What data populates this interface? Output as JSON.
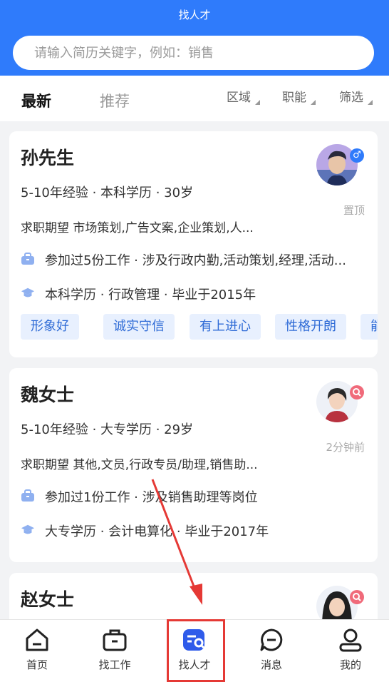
{
  "header": {
    "title": "找人才",
    "search_placeholder": "请输入简历关键字，例如：销售"
  },
  "filterbar": {
    "tabs": [
      {
        "label": "最新",
        "active": true
      },
      {
        "label": "推荐",
        "active": false
      }
    ],
    "filters": [
      {
        "label": "区域"
      },
      {
        "label": "职能"
      },
      {
        "label": "筛选"
      }
    ]
  },
  "candidates": [
    {
      "name": "孙先生",
      "summary": "5-10年经验 · 本科学历 · 30岁",
      "expectation": "求职期望 市场策划,广告文案,企业策划,人...",
      "work": "参加过5份工作 · 涉及行政内勤,活动策划,经理,活动...",
      "education": "本科学历 · 行政管理 · 毕业于2015年",
      "side_label": "置顶",
      "badge": "male-icon",
      "tags": [
        "形象好",
        "诚实守信",
        "有上进心",
        "性格开朗",
        "能"
      ]
    },
    {
      "name": "魏女士",
      "summary": "5-10年经验 · 大专学历 · 29岁",
      "expectation": "求职期望 其他,文员,行政专员/助理,销售助...",
      "work": "参加过1份工作 · 涉及销售助理等岗位",
      "education": "大专学历 · 会计电算化 · 毕业于2017年",
      "side_label": "2分钟前",
      "badge": "search-icon"
    },
    {
      "name": "赵女士",
      "badge": "search-icon"
    }
  ],
  "tabbar": {
    "items": [
      {
        "label": "首页",
        "icon": "home-icon"
      },
      {
        "label": "找工作",
        "icon": "briefcase-icon"
      },
      {
        "label": "找人才",
        "icon": "find-talent-icon",
        "active": true
      },
      {
        "label": "消息",
        "icon": "message-icon"
      },
      {
        "label": "我的",
        "icon": "profile-icon"
      }
    ]
  },
  "colors": {
    "primary": "#2f7bfb",
    "tag_bg": "#e8f0fe",
    "tag_text": "#2f6bd6",
    "annotation_red": "#e53935",
    "male_badge": "#2f7bfb",
    "search_badge": "#f06a7a"
  }
}
